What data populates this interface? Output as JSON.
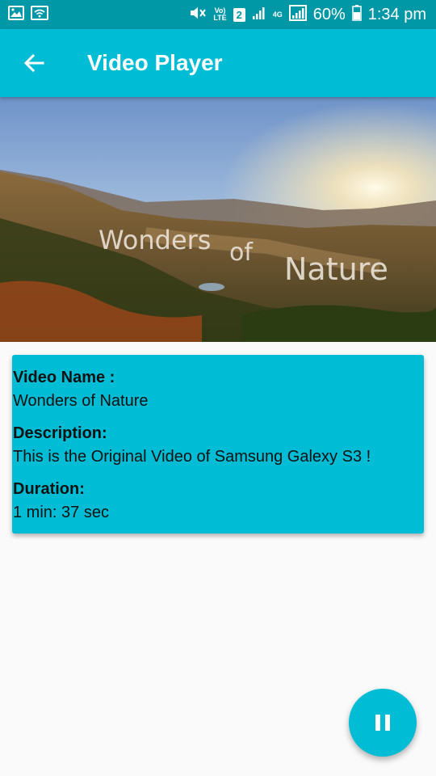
{
  "status_bar": {
    "icons_left": [
      "gallery-icon",
      "wifi-icon"
    ],
    "volte_top": "Vo)",
    "volte_bottom": "LTE",
    "sim_slot": "2",
    "network_type": "4G",
    "battery": "60%",
    "time": "1:34 pm"
  },
  "app_bar": {
    "back_icon": "arrow-back-icon",
    "title": "Video Player"
  },
  "video": {
    "overlay_words": [
      "Wonders",
      "of",
      "Nature"
    ]
  },
  "info": {
    "name_label": "Video Name :",
    "name_value": "Wonders of Nature",
    "description_label": "Description:",
    "description_value": "This is the Original Video of Samsung Galexy S3 !",
    "duration_label": "Duration:",
    "duration_value": "1 min: 37 sec"
  },
  "fab": {
    "icon": "pause-icon"
  },
  "colors": {
    "status_bar": "#0097a7",
    "primary": "#00bcd4",
    "background": "#fafafa"
  }
}
